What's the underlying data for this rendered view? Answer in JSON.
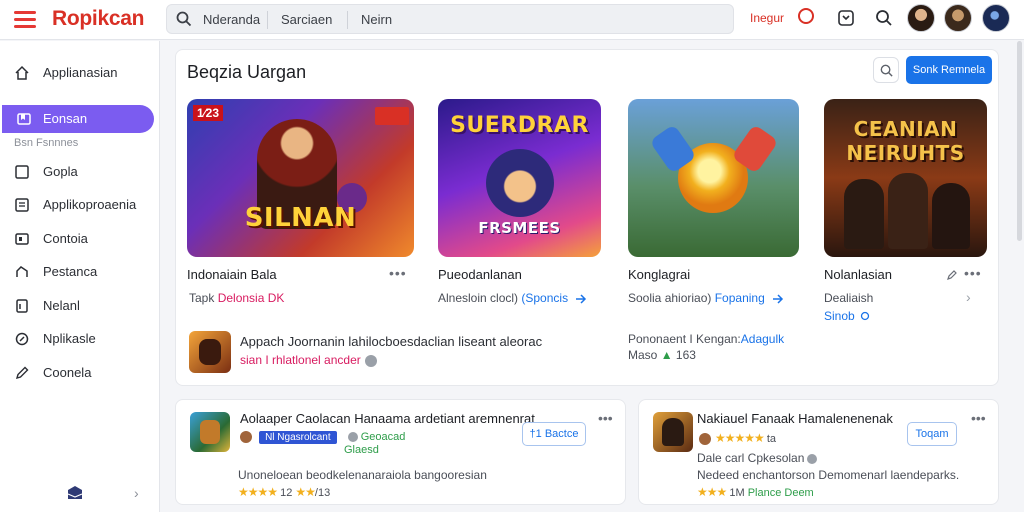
{
  "app": {
    "brand": "Ropikcan"
  },
  "search": {
    "segment1": "Nderanda",
    "segment2": "Sarciaen",
    "segment3": "Neirn"
  },
  "topbar": {
    "link": "Inegur"
  },
  "sidebar": {
    "items": [
      {
        "label": "Applianasian",
        "icon": "home-icon"
      },
      {
        "label": "Eonsan",
        "icon": "bookmark-icon"
      },
      {
        "label": "Gopla",
        "icon": "square-icon"
      },
      {
        "label": "Applikoproaenia",
        "icon": "list-icon"
      },
      {
        "label": "Contoia",
        "icon": "window-icon"
      },
      {
        "label": "Pestanca",
        "icon": "puzzle-icon"
      },
      {
        "label": "Nelanl",
        "icon": "document-icon"
      },
      {
        "label": "Nplikasle",
        "icon": "link-icon"
      },
      {
        "label": "Coonela",
        "icon": "pencil-icon"
      }
    ],
    "sub_label": "Bsn Fsnnnes"
  },
  "panel": {
    "title": "Beqzia Uargan",
    "button": "Sonk Remnela",
    "cards": [
      {
        "thumb_tag": "1⁄23",
        "thumb_title": "SILNAN",
        "title": "Indonaiain Bala",
        "meta_prefix": "Tapk ",
        "meta_highlight": "Delonsia",
        "meta_suffix": " DK",
        "accent": "#e9472f"
      },
      {
        "thumb_title": "SUERDRAR",
        "thumb_sub": "FRSMEES",
        "title": "Pueodanlanan",
        "meta_prefix": "Alnesloin clocl) ",
        "meta_link": "(Sponcis",
        "accent": "#6a2fd6"
      },
      {
        "title": "Konglagrai",
        "meta_prefix": "Soolia ahioriao) ",
        "meta_link": "Fopaning",
        "accent": "#2a8f5e"
      },
      {
        "thumb_title": "CEANIAN",
        "thumb_sub": "NEIRUHTS",
        "title": "Nolanlasian",
        "meta_line1": "Dealiaish",
        "meta_line2": "Sinob",
        "accent": "#b84a1c"
      }
    ],
    "promo": {
      "line1": "Appach Joornanin lahilocboesdaclian liseant aleorac",
      "line2": "sian I rhlatlonel ancder"
    },
    "note": {
      "prefix": "Pononaent I Kengan:",
      "link": "Adagulk",
      "line2_prefix": "Maso ",
      "line2_value": "163"
    }
  },
  "bottom_cards": [
    {
      "title": "Aolaaper Caolacan Hanaama ardetiant aremnenrat",
      "badge": "Nl Ngasrolcant",
      "tag": "Geoacad",
      "tag2": "Glaesd",
      "button": "†1 Bactce",
      "desc": "Unoneloean beodkelenanaraiola bangooresian",
      "rating_value": "12",
      "rating_value2": "/13"
    },
    {
      "title": "Nakiauel Fanaak Hamalenenenak",
      "rating_suffix": "ta",
      "button": "Toqam",
      "line2": "Dale carl Cpkesolan",
      "desc": "Nedeed enchantorson Demomenarl laendeparks.",
      "rating_value": "1M",
      "rating_tag": "Plance Deem"
    }
  ]
}
